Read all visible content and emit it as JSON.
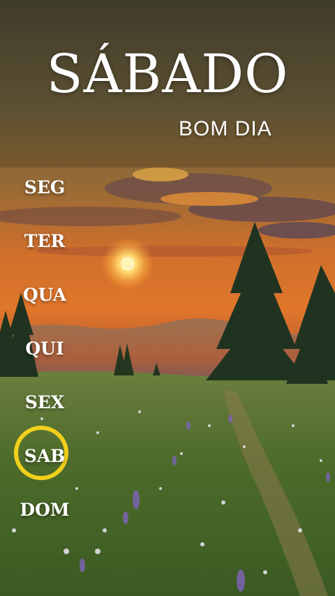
{
  "header": {
    "title": "SÁBADO",
    "subtitle": "BOM DIA"
  },
  "days": [
    "SEG",
    "TER",
    "QUA",
    "QUI",
    "SEX",
    "SAB",
    "DOM"
  ],
  "selected_day": "SAB",
  "colors": {
    "highlight_ring": "#f1cf1c",
    "text": "#ffffff"
  }
}
